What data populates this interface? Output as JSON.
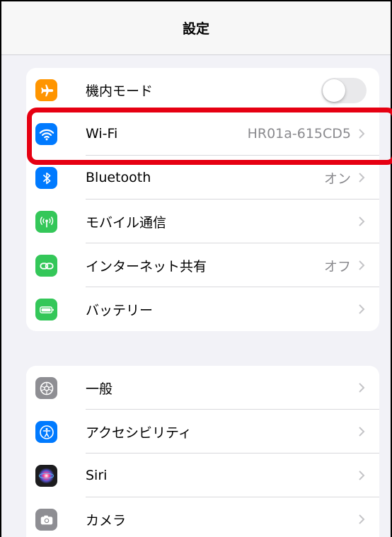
{
  "navbar": {
    "title": "設定"
  },
  "group1": {
    "items": [
      {
        "label": "機内モード",
        "icon": "airplane-icon",
        "color": "#ff9500",
        "toggle": false
      },
      {
        "label": "Wi-Fi",
        "icon": "wifi-icon",
        "color": "#007aff",
        "value": "HR01a-615CD5"
      },
      {
        "label": "Bluetooth",
        "icon": "bluetooth-icon",
        "color": "#007aff",
        "value": "オン"
      },
      {
        "label": "モバイル通信",
        "icon": "cellular-icon",
        "color": "#34c759",
        "value": ""
      },
      {
        "label": "インターネット共有",
        "icon": "hotspot-icon",
        "color": "#34c759",
        "value": "オフ"
      },
      {
        "label": "バッテリー",
        "icon": "battery-icon",
        "color": "#34c759",
        "value": ""
      }
    ]
  },
  "group2": {
    "items": [
      {
        "label": "一般",
        "icon": "gear-icon",
        "color": "#8e8e93"
      },
      {
        "label": "アクセシビリティ",
        "icon": "accessibility-icon",
        "color": "#007aff"
      },
      {
        "label": "Siri",
        "icon": "siri-icon",
        "color": "#222222"
      },
      {
        "label": "カメラ",
        "icon": "camera-icon",
        "color": "#8e8e93"
      }
    ]
  },
  "highlight_color": "#e60012"
}
